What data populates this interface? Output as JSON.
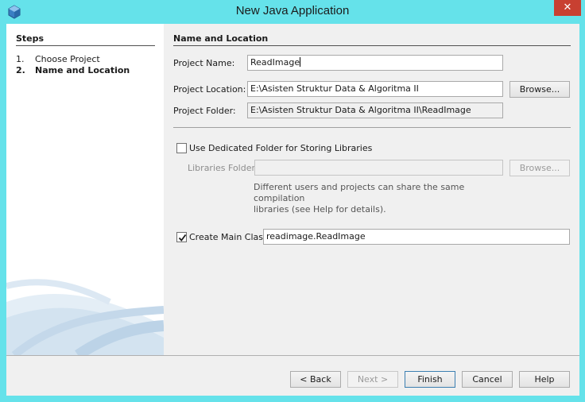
{
  "window": {
    "title": "New Java Application",
    "close_glyph": "✕",
    "icon": "netbeans-cube-icon"
  },
  "steps": {
    "heading": "Steps",
    "items": [
      {
        "num": "1.",
        "label": "Choose Project",
        "current": false
      },
      {
        "num": "2.",
        "label": "Name and Location",
        "current": true
      }
    ]
  },
  "panel": {
    "heading": "Name and Location",
    "project_name_label": "Project Name:",
    "project_name_value": "ReadImage",
    "project_location_label": "Project Location:",
    "project_location_value": "E:\\Asisten Struktur Data & Algoritma II",
    "browse_label": "Browse...",
    "project_folder_label": "Project Folder:",
    "project_folder_value": "E:\\Asisten Struktur Data & Algoritma II\\ReadImage",
    "dedicated_folder_label": "Use Dedicated Folder for Storing Libraries",
    "dedicated_folder_checked": false,
    "libraries_folder_label": "Libraries Folder:",
    "libraries_folder_value": "",
    "libraries_browse_label": "Browse...",
    "hint_line1": "Different users and projects can share the same compilation",
    "hint_line2": "libraries (see Help for details).",
    "create_main_class_label": "Create Main Class",
    "create_main_class_checked": true,
    "main_class_value": "readimage.ReadImage"
  },
  "footer": {
    "back_label": "< Back",
    "next_label": "Next >",
    "finish_label": "Finish",
    "cancel_label": "Cancel",
    "help_label": "Help"
  },
  "colors": {
    "frame": "#65e2ea",
    "close": "#c84031",
    "client": "#f0f0f0"
  }
}
